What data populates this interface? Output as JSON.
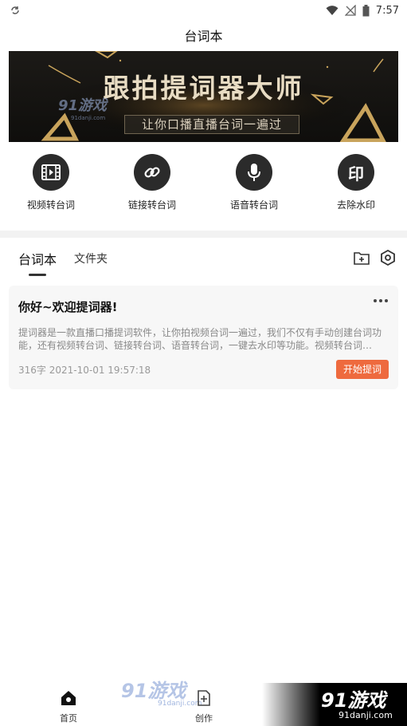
{
  "status": {
    "time": "7:57"
  },
  "app": {
    "title": "台词本"
  },
  "banner": {
    "title": "跟拍提词器大师",
    "subtitle": "让你口播直播台词一遍过",
    "watermark": "91游戏",
    "watermark_domain": "91danji.com"
  },
  "tools": [
    {
      "label": "视频转台词",
      "icon": "film-icon"
    },
    {
      "label": "链接转台词",
      "icon": "link-icon"
    },
    {
      "label": "语音转台词",
      "icon": "microphone-icon"
    },
    {
      "label": "去除水印",
      "icon": "stamp-icon",
      "glyph": "印"
    }
  ],
  "tabs": {
    "active": "台词本",
    "inactive": "文件夹"
  },
  "card": {
    "title": "你好~欢迎提词器!",
    "body": "提词器是一款直播口播提词软件，让你拍视频台词一遍过，我们不仅有手动创建台词功能，还有视频转台词、链接转台词、语音转台词，一键去水印等功能。视频转台词…",
    "meta": "316字 2021-10-01 19:57:18",
    "button": "开始提词"
  },
  "nav": {
    "home": "首页",
    "create": "创作",
    "watermark": "91游戏",
    "watermark_domain": "91danji.com"
  },
  "brand": {
    "name": "91游戏",
    "domain": "91danji.com"
  },
  "colors": {
    "accent": "#ee6a3e",
    "icon_bg": "#2b2b2b",
    "banner_gold": "#c9a45c"
  }
}
